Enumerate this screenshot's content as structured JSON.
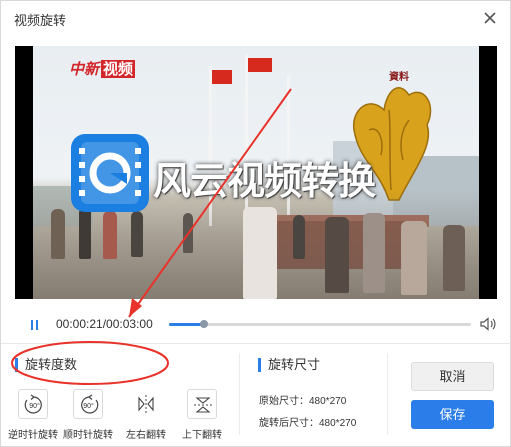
{
  "dialog": {
    "title": "视频旋转",
    "close_icon": "close-icon"
  },
  "video": {
    "logo_text": "中新",
    "logo_box_text": "视频",
    "watermark_text": "資料",
    "overlay_text": "风云视频转换"
  },
  "player": {
    "time": "00:00:21/00:03:00",
    "progress": 0.117,
    "pause_icon": "pause-icon",
    "volume_icon": "volume-icon"
  },
  "rotation": {
    "section_title": "旋转度数",
    "buttons": [
      {
        "label": "逆时针旋转",
        "icon": "rotate-ccw-icon",
        "icon_text": "90°"
      },
      {
        "label": "顺时针旋转",
        "icon": "rotate-cw-icon",
        "icon_text": "90°"
      },
      {
        "label": "左右翻转",
        "icon": "flip-horizontal-icon"
      },
      {
        "label": "上下翻转",
        "icon": "flip-vertical-icon"
      }
    ]
  },
  "size": {
    "section_title": "旋转尺寸",
    "original_label": "原始尺寸：480*270",
    "rotated_label": "旋转后尺寸：480*270"
  },
  "actions": {
    "cancel_label": "取消",
    "save_label": "保存"
  },
  "colors": {
    "accent": "#2b7de9",
    "annotation": "#e8322a"
  }
}
